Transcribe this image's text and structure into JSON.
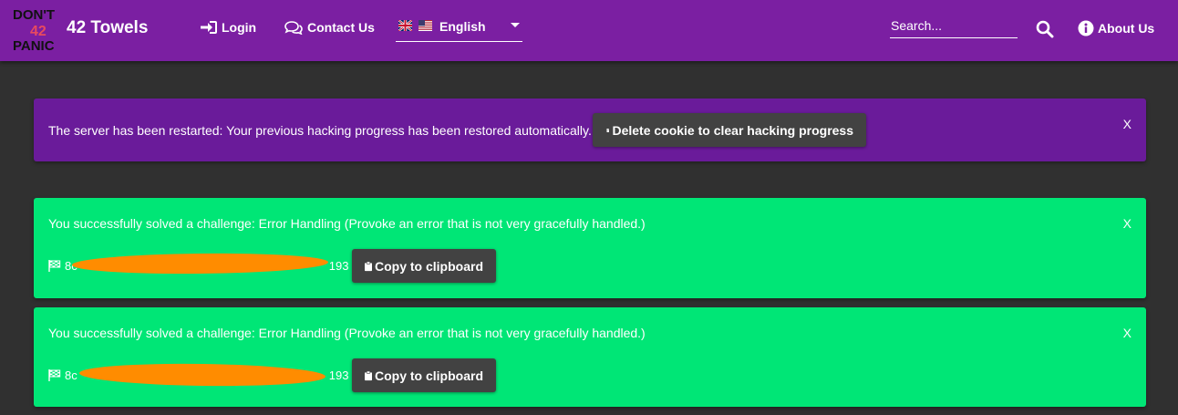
{
  "theme": {
    "nav_bg": "#7b1fa2",
    "server_notice_bg": "#6a1b9a",
    "solved_notice_bg": "#00e676",
    "button_bg": "#424242",
    "redaction_color": "#ff8c00",
    "page_bg": "#303030"
  },
  "navbar": {
    "logo_lines": [
      "DON'T",
      "42",
      "PANIC"
    ],
    "brand": "42 Towels",
    "login_label": "Login",
    "contact_label": "Contact Us",
    "language": {
      "selected": "English",
      "flags": [
        "flag-uk-icon",
        "flag-us-icon"
      ]
    },
    "search_placeholder": "Search...",
    "about_label": "About Us"
  },
  "server_notice": {
    "message": "The server has been restarted: Your previous hacking progress has been restored automatically.",
    "button_label": "Delete cookie to clear hacking progress",
    "close_label": "X"
  },
  "solved_notices": [
    {
      "message": "You successfully solved a challenge: Error Handling (Provoke an error that is not very gracefully handled.)",
      "code_visible_start": "8c",
      "code_visible_end": "193",
      "button_label": "Copy to clipboard",
      "close_label": "X"
    },
    {
      "message": "You successfully solved a challenge: Error Handling (Provoke an error that is not very gracefully handled.)",
      "code_visible_start": "8c",
      "code_visible_end": "193",
      "button_label": "Copy to clipboard",
      "close_label": "X"
    }
  ]
}
